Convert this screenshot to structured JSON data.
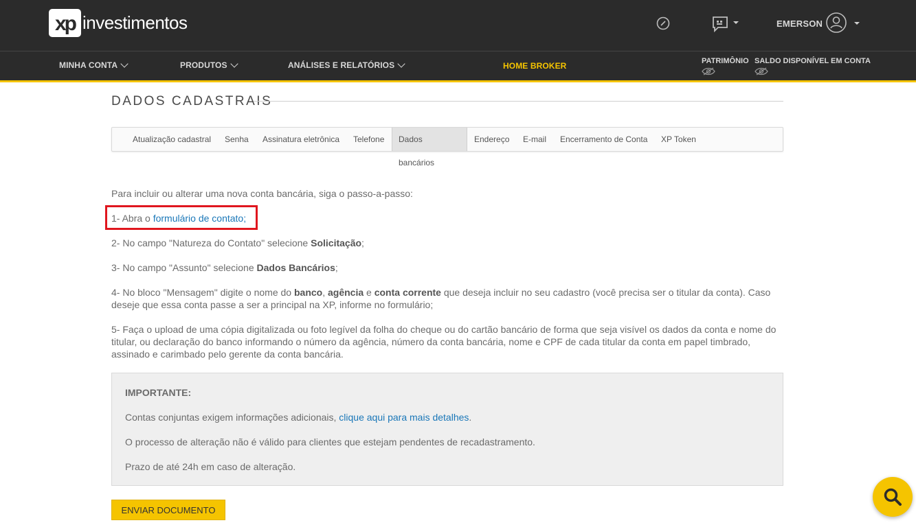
{
  "header": {
    "logo_mark": "xp",
    "logo_text": "investimentos",
    "user_name": "EMERSON"
  },
  "nav": {
    "items": [
      {
        "label": "MINHA CONTA"
      },
      {
        "label": "PRODUTOS"
      },
      {
        "label": "ANÁLISES E RELATÓRIOS"
      },
      {
        "label": "HOME BROKER"
      }
    ],
    "patrimonio_label": "PATRIMÔNIO",
    "saldo_label": "SALDO DISPONÍVEL EM CONTA"
  },
  "page": {
    "title": "DADOS CADASTRAIS",
    "tabs": [
      "Atualização cadastral",
      "Senha",
      "Assinatura eletrônica",
      "Telefone",
      "Dados bancários",
      "Endereço",
      "E-mail",
      "Encerramento de Conta",
      "XP Token"
    ],
    "active_tab": "Dados bancários"
  },
  "content": {
    "intro": "Para incluir ou alterar uma nova conta bancária, siga o passo-a-passo:",
    "step1_prefix": "1- Abra o ",
    "step1_link": "formulário de contato",
    "step1_suffix": ";",
    "step2_prefix": "2- No campo \"Natureza do Contato\" selecione ",
    "step2_bold": "Solicitação",
    "step2_suffix": ";",
    "step3_prefix": "3- No campo \"Assunto\" selecione ",
    "step3_bold": "Dados Bancários",
    "step3_suffix": ";",
    "step4_a": "4- No bloco \"Mensagem\" digite o nome do ",
    "step4_b": "banco",
    "step4_c": ", ",
    "step4_d": "agência",
    "step4_e": " e ",
    "step4_f": "conta corrente",
    "step4_g": " que deseja incluir no seu cadastro (você precisa ser o titular da conta). Caso",
    "step4_line2": "deseje que essa conta passe a ser a principal na XP, informe no formulário;",
    "step5_line1": "5- Faça o upload de uma cópia digitalizada ou foto legível da folha do cheque ou do cartão bancário de forma que seja visível os dados da conta e nome do",
    "step5_line2": "titular, ou declaração do banco informando o número da agência, número da conta bancária, nome e CPF de cada titular da conta em papel timbrado,",
    "step5_line3": "assinado e carimbado pelo gerente da conta bancária."
  },
  "important": {
    "title": "IMPORTANTE:",
    "line1_prefix": "Contas conjuntas exigem informações adicionais, ",
    "line1_link": "clique aqui para mais detalhes",
    "line1_suffix": ".",
    "line2": "O processo de alteração não é válido para clientes que estejam pendentes de recadastramento.",
    "line3": "Prazo de até 24h em caso de alteração."
  },
  "actions": {
    "send_label": "ENVIAR DOCUMENTO"
  },
  "colors": {
    "accent": "#f5c400",
    "header_bg": "#2b2b2b",
    "link": "#1a77b8",
    "highlight_box": "#e0161e"
  }
}
